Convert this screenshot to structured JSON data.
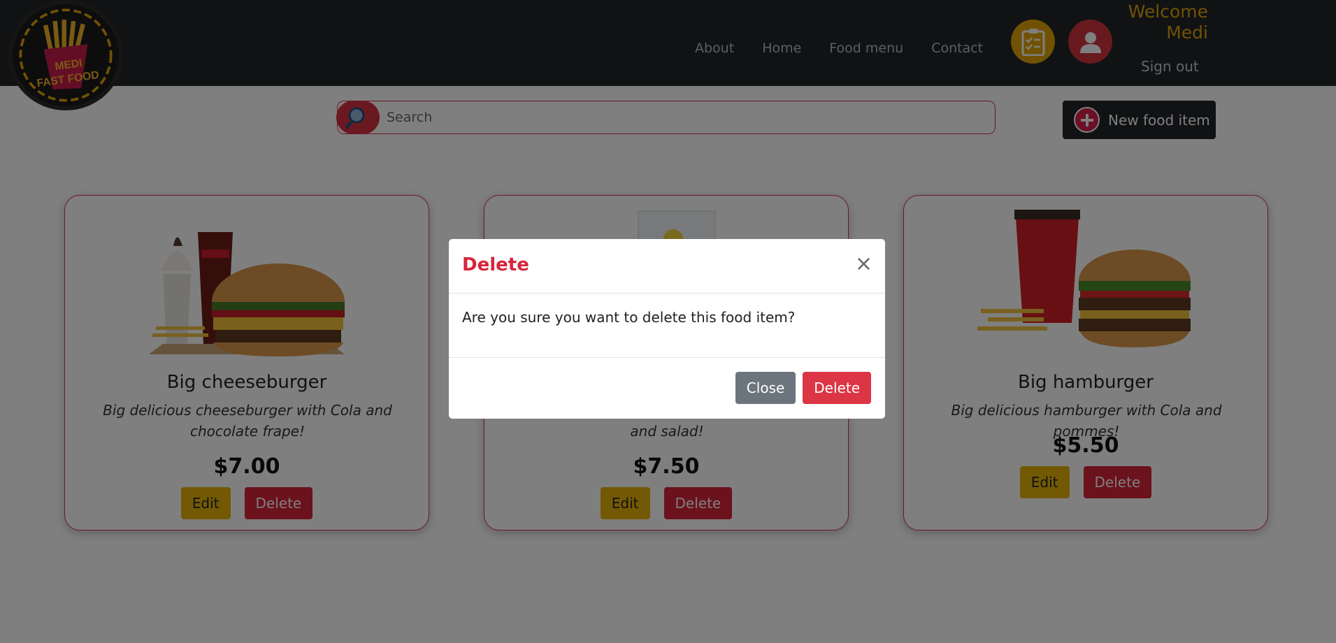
{
  "brand": {
    "line1": "MEDI",
    "line2": "FAST FOOD"
  },
  "nav": {
    "links": [
      "About",
      "Home",
      "Food menu",
      "Contact"
    ],
    "welcome_line1": "Welcome",
    "welcome_line2": "Medi",
    "signout": "Sign out"
  },
  "search": {
    "placeholder": "Search"
  },
  "new_item_label": "New food item",
  "cards": [
    {
      "title": "Big cheeseburger",
      "desc": "Big delicious cheeseburger with Cola and chocolate frape!",
      "price": "$7.00",
      "edit": "Edit",
      "delete": "Delete"
    },
    {
      "title": "",
      "desc": "and salad!",
      "price": "$7.50",
      "edit": "Edit",
      "delete": "Delete"
    },
    {
      "title": "Big hamburger",
      "desc": "Big delicious hamburger with Cola and pommes!",
      "price": "$5.50",
      "edit": "Edit",
      "delete": "Delete"
    }
  ],
  "modal": {
    "title": "Delete",
    "close_symbol": "×",
    "message": "Are you sure you want to delete this food item?",
    "close_label": "Close",
    "delete_label": "Delete"
  },
  "colors": {
    "navbar": "#212529",
    "accent_yellow": "#e3a508",
    "accent_red": "#dc3545"
  }
}
